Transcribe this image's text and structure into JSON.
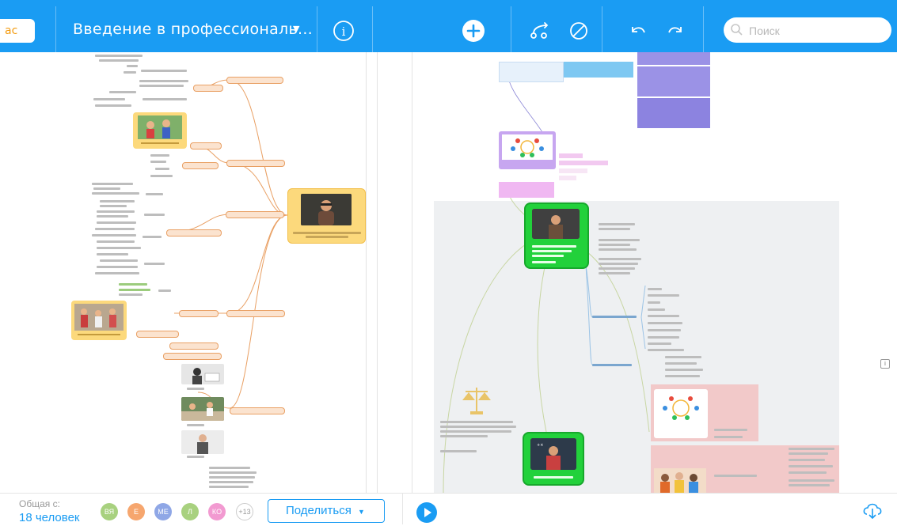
{
  "header": {
    "back_label": "ас",
    "title": "Введение в профессиональ...",
    "search_placeholder": "Поиск"
  },
  "footer": {
    "shared_label": "Общая с:",
    "shared_count": "18 человек",
    "avatars": [
      {
        "initials": "ВЯ",
        "color": "#a8d17f"
      },
      {
        "initials": "Е",
        "color": "#f6a66e"
      },
      {
        "initials": "МЕ",
        "color": "#8fa7e6"
      },
      {
        "initials": "Л",
        "color": "#a8d17f"
      },
      {
        "initials": "КО",
        "color": "#f29ad1"
      }
    ],
    "more_label": "+13",
    "share_label": "Поделиться"
  },
  "colors": {
    "header_bg": "#1a9cf3",
    "accent": "#1a9cf3",
    "central_node": "#fcd97c",
    "green_node": "#22d13b",
    "branch_orange": "#e9a064",
    "purple_node": "#9b92e6",
    "pink_zone": "#f2c9c9"
  },
  "icons": [
    "info-icon",
    "add-icon",
    "branch-icon",
    "no-icon",
    "undo-icon",
    "redo-icon",
    "search-icon",
    "play-icon",
    "cloud-download-icon"
  ]
}
